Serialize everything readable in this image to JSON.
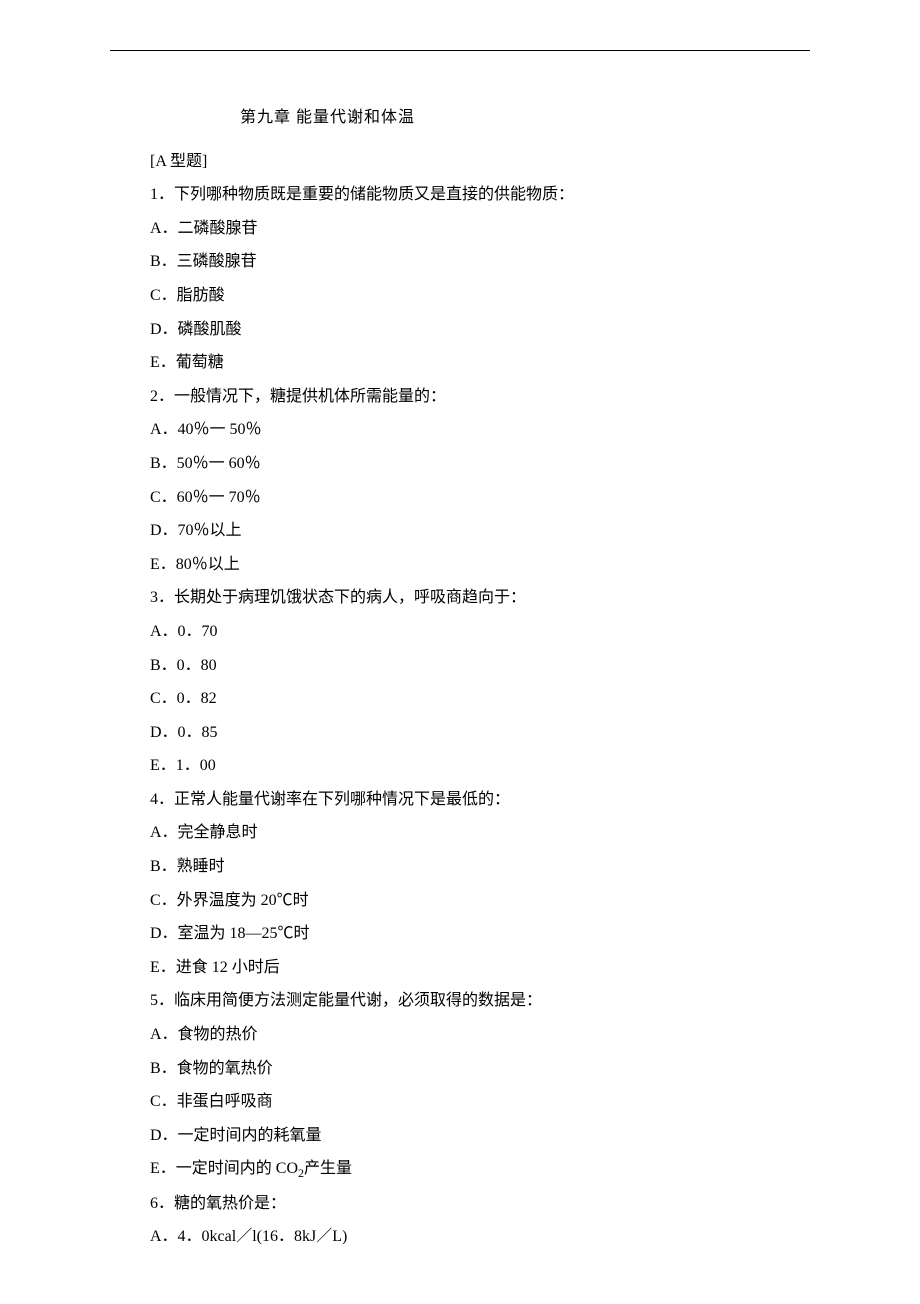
{
  "chapter_title": "第九章    能量代谢和体温",
  "section_label": "[A 型题]",
  "questions": [
    {
      "stem": "1．下列哪种物质既是重要的储能物质又是直接的供能物质：",
      "options": [
        "A．二磷酸腺苷",
        "B．三磷酸腺苷",
        "C．脂肪酸",
        "D．磷酸肌酸",
        "E．葡萄糖"
      ]
    },
    {
      "stem": "2．一般情况下，糖提供机体所需能量的：",
      "options": [
        "A．40％一 50％",
        "B．50％一 60％",
        "C．60％一 70％",
        "D．70％以上",
        "E．80％以上"
      ]
    },
    {
      "stem": "3．长期处于病理饥饿状态下的病人，呼吸商趋向于：",
      "options": [
        "A．0．70",
        "B．0．80",
        "C．0．82",
        "D．0．85",
        "E．1．00"
      ]
    },
    {
      "stem": "4．正常人能量代谢率在下列哪种情况下是最低的：",
      "options": [
        "A．完全静息时",
        "B．熟睡时",
        "C．外界温度为 20℃时",
        "D．室温为 18—25℃时",
        "E．进食 12 小时后"
      ]
    },
    {
      "stem": "5．临床用简便方法测定能量代谢，必须取得的数据是：",
      "options": [
        "A．食物的热价",
        "B．食物的氧热价",
        "C．非蛋白呼吸商",
        "D．一定时间内的耗氧量",
        "E．一定时间内的 CO₂产生量"
      ]
    },
    {
      "stem": "6．糖的氧热价是：",
      "options": [
        "A．4．0kcal／l(16．8kJ／L)"
      ]
    }
  ]
}
